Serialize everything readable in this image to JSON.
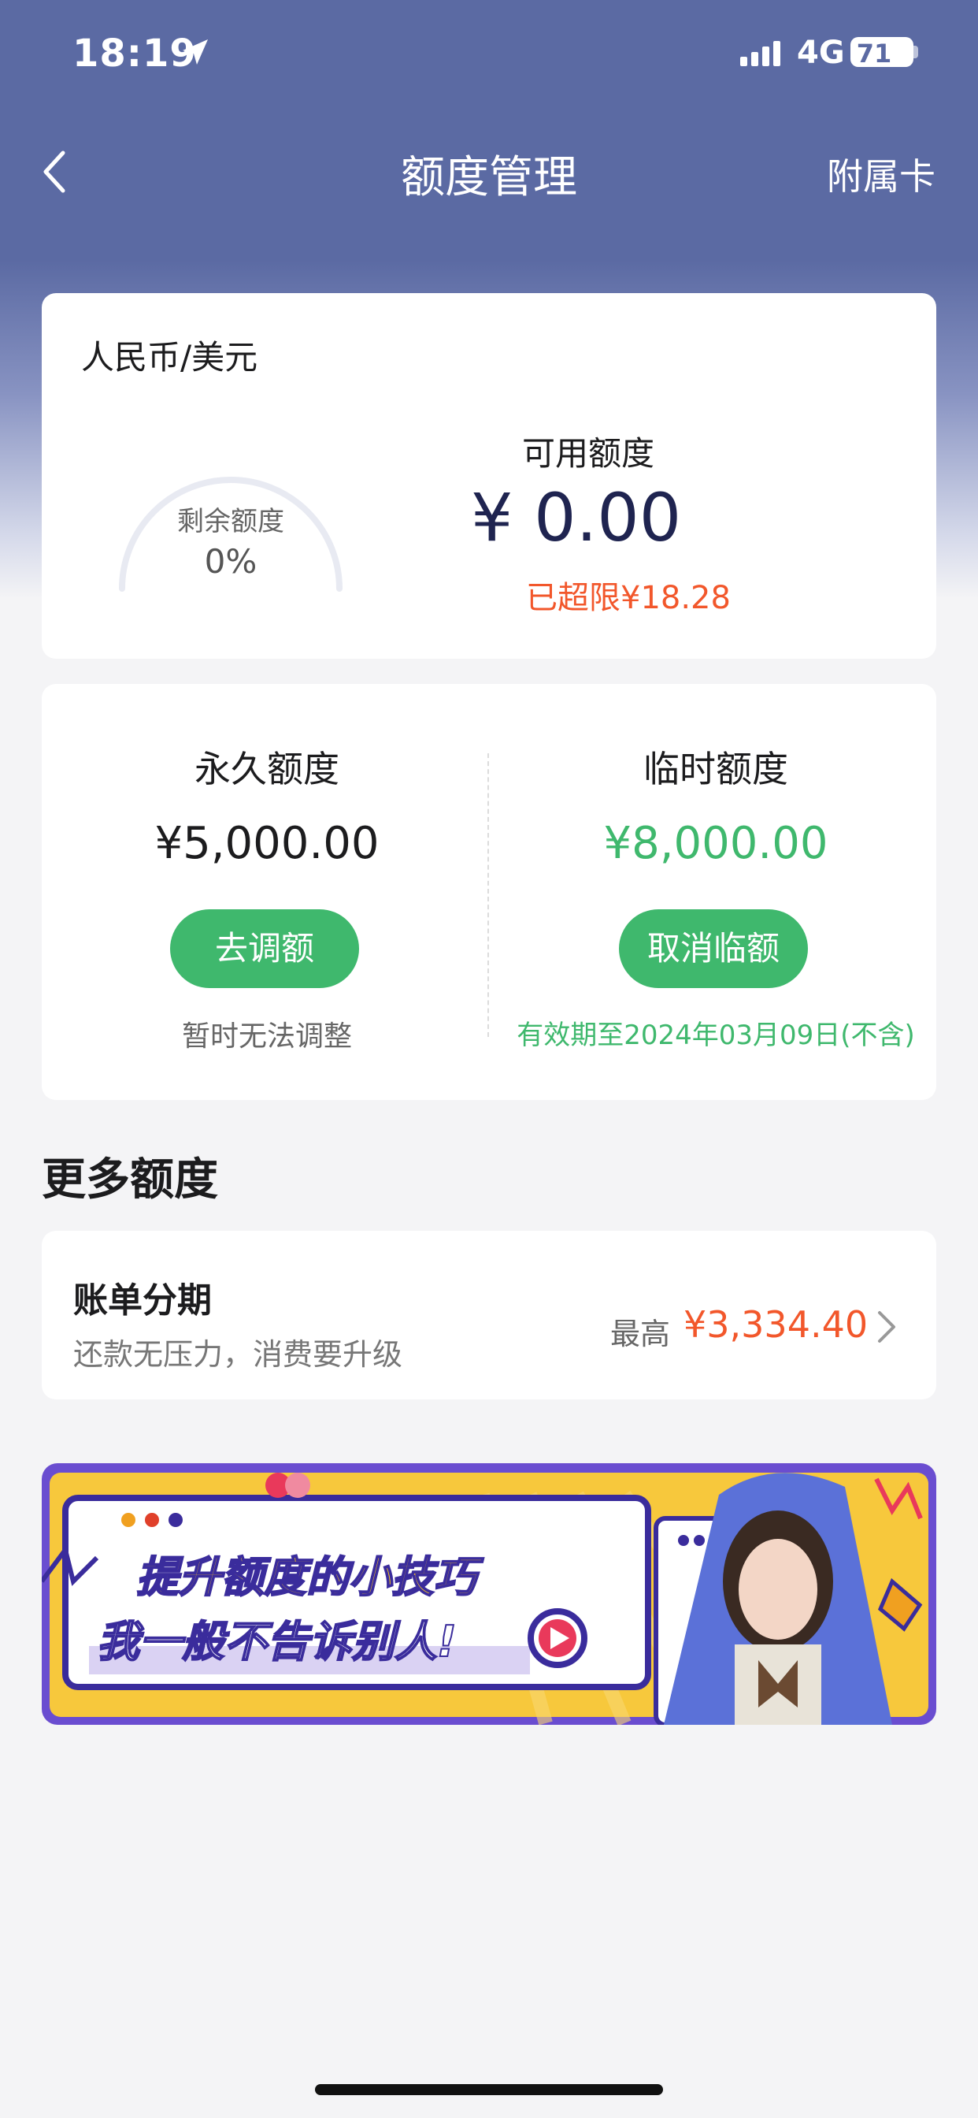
{
  "status_bar": {
    "time": "18:19",
    "network": "4G",
    "battery": "71"
  },
  "nav": {
    "title": "额度管理",
    "right_label": "附属卡"
  },
  "summary": {
    "currency_label": "人民币/美元",
    "remaining_label": "剩余额度",
    "remaining_value": "0%",
    "available_label": "可用额度",
    "available_value": "¥ 0.00",
    "over_limit": "已超限¥18.28"
  },
  "limits": {
    "permanent": {
      "label": "永久额度",
      "value": "¥5,000.00",
      "button": "去调额",
      "note": "暂时无法调整"
    },
    "temporary": {
      "label": "临时额度",
      "value": "¥8,000.00",
      "button": "取消临额",
      "note": "有效期至2024年03月09日(不含)"
    }
  },
  "more": {
    "section_title": "更多额度",
    "installment": {
      "title": "账单分期",
      "subtitle": "还款无压力，消费要升级",
      "max_label": "最高",
      "max_value": "¥3,334.40"
    }
  },
  "banner": {
    "line1": "提升额度的小技巧",
    "line2": "我一般不告诉别人!"
  },
  "colors": {
    "header": "#5b6aa3",
    "green": "#3fb86d",
    "orange": "#f2572b",
    "navy": "#1f2450"
  }
}
